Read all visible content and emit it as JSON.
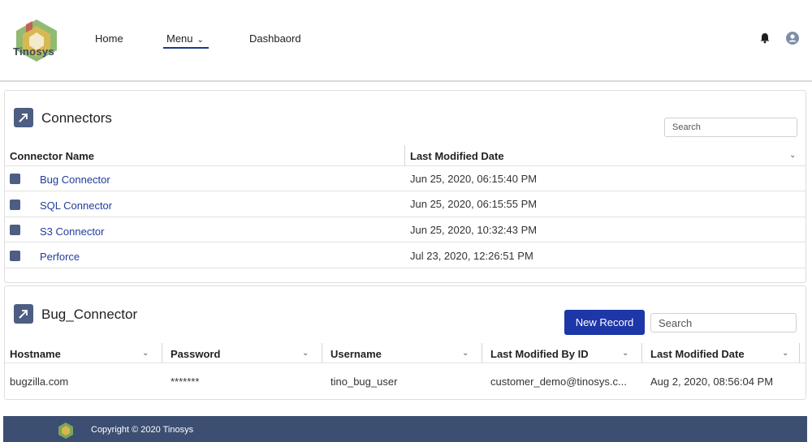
{
  "brand": {
    "name": "Tinosys"
  },
  "nav": {
    "home": "Home",
    "menu": "Menu",
    "dashboard": "Dashbaord"
  },
  "connectors": {
    "title": "Connectors",
    "search_placeholder": "Search",
    "col_name": "Connector Name",
    "col_date": "Last Modified Date",
    "rows": [
      {
        "name": "Bug Connector",
        "date": "Jun 25, 2020, 06:15:40 PM"
      },
      {
        "name": "SQL Connector",
        "date": "Jun 25, 2020, 06:15:55 PM"
      },
      {
        "name": "S3 Connector",
        "date": "Jun 25, 2020, 10:32:43 PM"
      },
      {
        "name": "Perforce",
        "date": "Jul 23, 2020, 12:26:51 PM"
      }
    ]
  },
  "bug_connector": {
    "title": "Bug_Connector",
    "new_record": "New Record",
    "search_placeholder": "Search",
    "columns": [
      "Hostname",
      "Password",
      "Username",
      "Last Modified By ID",
      "Last Modified Date"
    ],
    "row": [
      "bugzilla.com",
      "*******",
      "tino_bug_user",
      "customer_demo@tinosys.c...",
      "Aug 2, 2020, 08:56:04 PM"
    ]
  },
  "footer": {
    "copyright": "Copyright © 2020 Tinosys"
  },
  "colors": {
    "primary": "#1d36a8",
    "link": "#213c9c",
    "footer": "#3c4e71",
    "icon": "#4d5d83"
  }
}
